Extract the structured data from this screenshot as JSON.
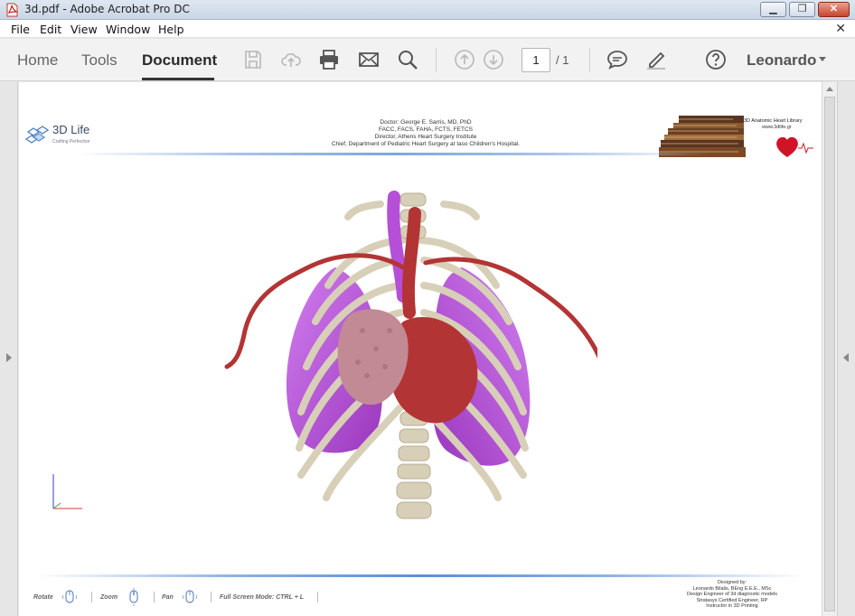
{
  "window": {
    "title": "3d.pdf - Adobe Acrobat Pro DC"
  },
  "menu": [
    "File",
    "Edit",
    "View",
    "Window",
    "Help"
  ],
  "tabs": {
    "home": "Home",
    "tools": "Tools",
    "document": "Document"
  },
  "toolbar": {
    "icons": [
      "save-icon",
      "upload-icon",
      "print-icon",
      "email-icon",
      "search-icon",
      "page-up-icon",
      "page-down-icon",
      "comment-icon",
      "highlight-icon",
      "help-icon"
    ],
    "page_current": "1",
    "page_total": "/ 1",
    "user_name": "Leonardo"
  },
  "document": {
    "logo_name": "3D Life",
    "logo_tagline": "Crafting Perfection",
    "header_lines": [
      "Doctor: George E. Sarris, MD, PhD",
      "FACC, FACS, FAHA, FCTS, FETCS",
      "Director, Athens Heart Surgery Institute",
      "Chief, Department of Pediatric Heart Surgery at Iaso Children's Hospital."
    ],
    "library_title": "3D Anatomic Heart Library",
    "library_url": "www.3dlife.gr",
    "nav": {
      "rotate": "Rotate",
      "zoom": "Zoom",
      "pan": "Pan",
      "fullscreen": "Full Screen Mode:  CTRL + L"
    },
    "credits": [
      "Designed by:",
      "Leonardo Bilalis, BEng E.E.E., MSc",
      "Design Engineer of 3d diagnostic models",
      "Stratasys Certified Engineer, RP",
      "Instructor in 3D Printing"
    ]
  },
  "colors": {
    "lung": "#b54fd8",
    "bone": "#d8cfb8",
    "heart": "#b33434",
    "tab_underline": "#333333"
  }
}
